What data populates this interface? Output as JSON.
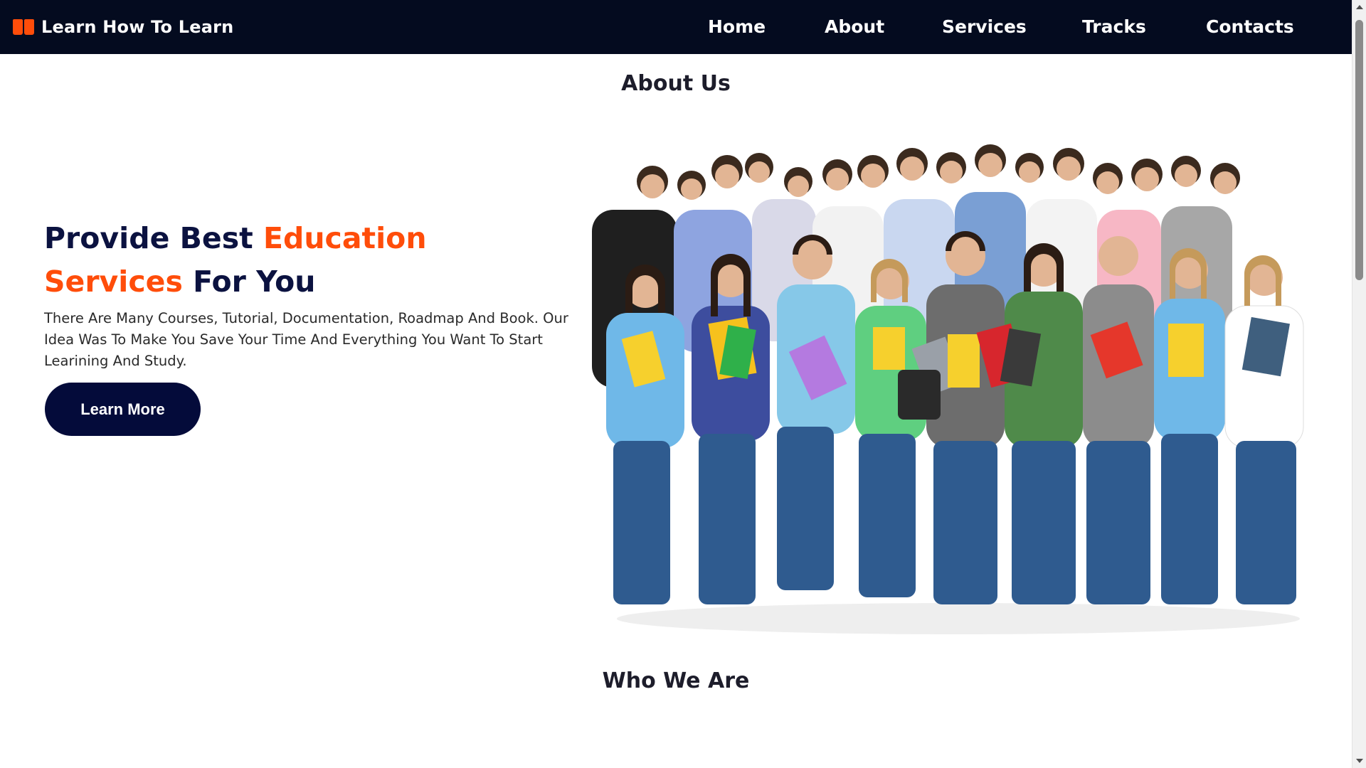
{
  "navbar": {
    "brand": "Learn How To Learn",
    "brand_icon": "open-book-icon",
    "links": [
      "Home",
      "About",
      "Services",
      "Tracks",
      "Contacts"
    ]
  },
  "about": {
    "title": "About Us",
    "heading_part1": "Provide Best ",
    "heading_accent1": "Education",
    "heading_accent2": "Services",
    "heading_part2": " For You",
    "description": "There Are Many Courses, Tutorial, Documentation, Roadmap And Book. Our Idea Was To Make You Save Your Time And Everything You Want To Start Learining And Study.",
    "button": "Learn More"
  },
  "who_we_are": {
    "title": "Who We Are"
  },
  "colors": {
    "nav_bg": "#040b1f",
    "accent": "#ff4d0a",
    "heading": "#0b1240",
    "button_bg": "#040b3a"
  }
}
